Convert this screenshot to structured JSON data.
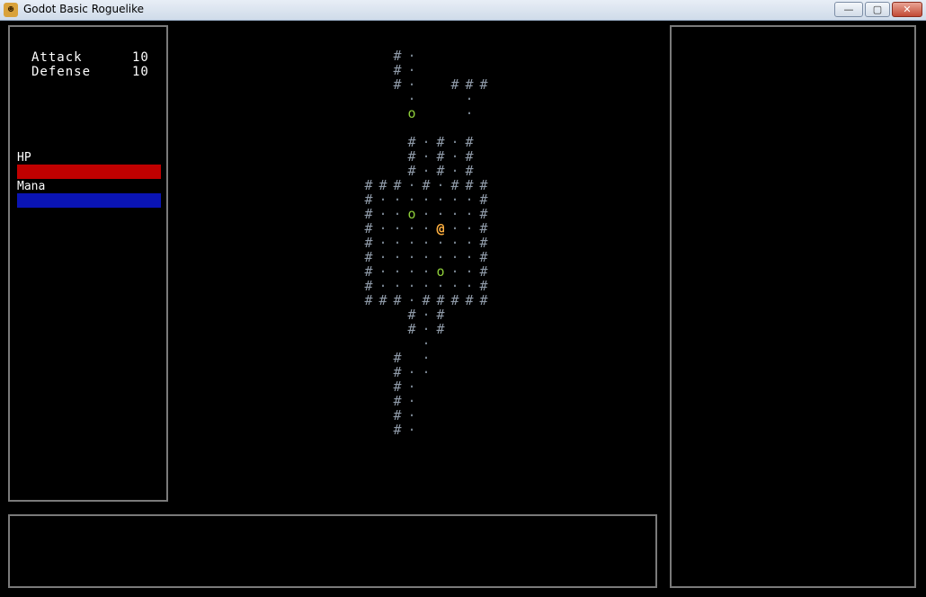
{
  "window": {
    "title": "Godot Basic Roguelike",
    "icon": "godot-icon",
    "minimize_glyph": "—",
    "maximize_glyph": "▢",
    "close_glyph": "✕"
  },
  "stats": [
    {
      "label": "Attack",
      "value": "10"
    },
    {
      "label": "Defense",
      "value": "10"
    }
  ],
  "bars": [
    {
      "label": "HP",
      "color": "#c00000",
      "fill": 1.0
    },
    {
      "label": "Mana",
      "color": "#0a14b4",
      "fill": 1.0
    }
  ],
  "map": {
    "glyphs": {
      "wall": "#",
      "floor": "·",
      "player": "@",
      "enemy": "o"
    },
    "rows": [
      "  #·          ",
      "  #·          ",
      "  #·  ###     ",
      "   ·   ·      ",
      "   o   ·      ",
      "              ",
      "   #·#·#      ",
      "   #·#·#      ",
      "   #·#·#      ",
      "###·#·###     ",
      "#·······#     ",
      "#··o····#     ",
      "#····@··#     ",
      "#·······#     ",
      "#·······#     ",
      "#····o··#     ",
      "#·······#     ",
      "###·#####     ",
      "   #·#        ",
      "   #·#        ",
      "    ·         ",
      "  # ·         ",
      "  #··         ",
      "  #·          ",
      "  #·          ",
      "  #·          ",
      "  #·          "
    ]
  },
  "message_log": [],
  "side_panel": []
}
